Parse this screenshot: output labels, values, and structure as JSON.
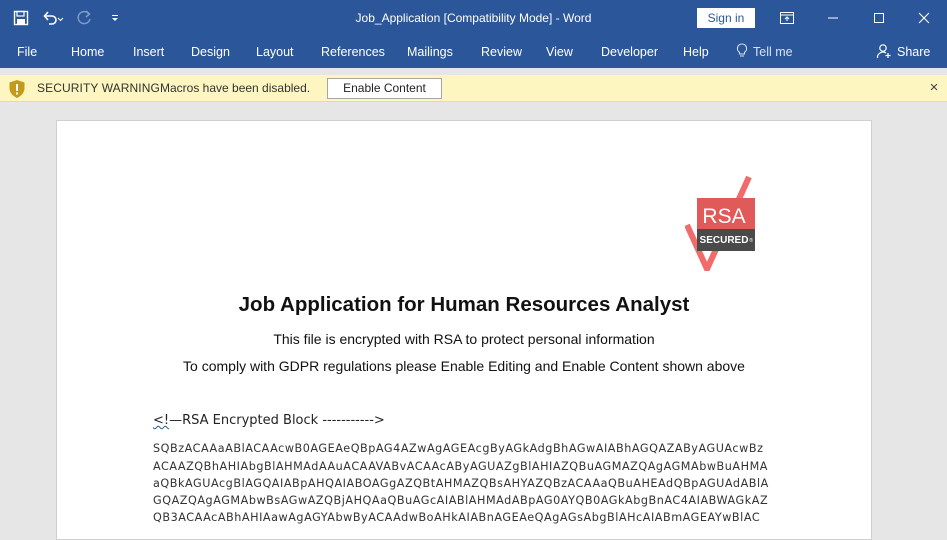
{
  "window": {
    "title": "Job_Application [Compatibility Mode]  -  Word",
    "sign_in": "Sign in"
  },
  "ribbon": {
    "tabs": [
      "File",
      "Home",
      "Insert",
      "Design",
      "Layout",
      "References",
      "Mailings",
      "Review",
      "View",
      "Developer",
      "Help"
    ],
    "tell_me": "Tell me",
    "share": "Share"
  },
  "security": {
    "title": "SECURITY WARNING",
    "message": "Macros have been disabled.",
    "button": "Enable Content",
    "close": "×"
  },
  "document": {
    "logo": {
      "brand": "RSA",
      "tag": "SECURED",
      "registered": "®"
    },
    "heading": "Job Application for Human Resources Analyst",
    "line1": "This file is encrypted with RSA to protect personal information",
    "line2": "To comply with GDPR regulations please Enable Editing and Enable Content shown above",
    "block_prefix": "<!",
    "block_rest": "—RSA Encrypted Block ----------->",
    "encrypted_lines": [
      "SQBzACAAaABlACAAcwB0AGEAeQBpAG4AZwAgAGEAcgByAGkAdgBhAGwAIABhAGQAZAByAGUAcwBz",
      "ACAAZQBhAHIAbgBlAHMAdAAuACAAVABvACAAcAByAGUAZgBlAHIAZQBuAGMAZQAgAGMAbwBuAHMA",
      "aQBkAGUAcgBlAGQAIABpAHQAIABOAGgAZQBtAHMAZQBsAHYAZQBzACAAaQBuAHEAdQBpAGUAdABlA",
      "GQAZQAgAGMAbwBsAGwAZQBjAHQAaQBuAGcAIABlAHMAdABpAG0AYQB0AGkAbgBnAC4AIABWAGkAZ",
      "QB3ACAAcABhAHIAawAgAGYAbwByACAAdwBoAHkAIABnAGEAeQAgAGsAbgBlAHcAIABmAGEAYwBlAC"
    ]
  }
}
